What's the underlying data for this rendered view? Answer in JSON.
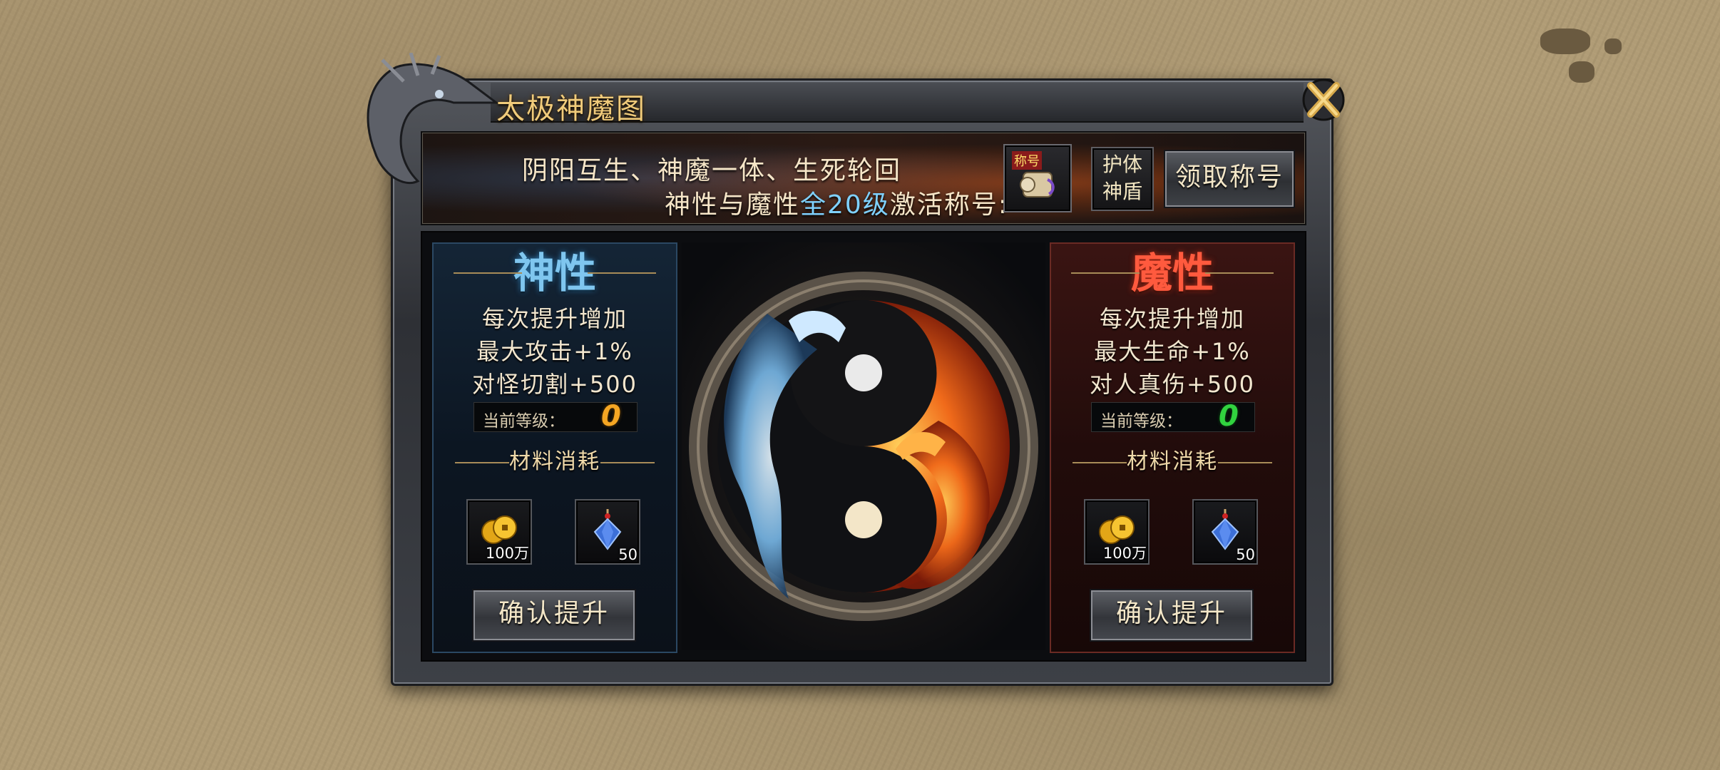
{
  "window": {
    "title": "太极神魔图"
  },
  "banner": {
    "line1": "阴阳互生、神魔一体、生死轮回",
    "line2_prefix": "神性与魔性",
    "line2_highlight": "全20级",
    "line2_suffix": "激活称号:",
    "title_item_tag": "称号",
    "shield_line1": "护体",
    "shield_line2": "神盾",
    "claim_button": "领取称号"
  },
  "divine": {
    "title": "神性",
    "desc1": "每次提升增加",
    "desc2": "最大攻击+1%",
    "desc3": "对怪切割+500",
    "level_label": "当前等级：",
    "level_value": "0",
    "materials_title": "材料消耗",
    "gold_count": "100万",
    "gem_count": "50",
    "confirm_button": "确认提升"
  },
  "demonic": {
    "title": "魔性",
    "desc1": "每次提升增加",
    "desc2": "最大生命+1%",
    "desc3": "对人真伤+500",
    "level_label": "当前等级：",
    "level_value": "0",
    "materials_title": "材料消耗",
    "gold_count": "100万",
    "gem_count": "50",
    "confirm_button": "确认提升"
  },
  "colors": {
    "title_gold": "#f0cb7a",
    "divine_blue": "#7fc6ef",
    "demonic_red": "#ff5a3e",
    "level_orange": "#f5a623",
    "level_green": "#31d33f"
  },
  "icons": [
    "dragon-ornament-icon",
    "close-icon",
    "scroll-icon",
    "gold-coins-icon",
    "gem-pendant-icon",
    "yin-yang-dragons-icon"
  ]
}
